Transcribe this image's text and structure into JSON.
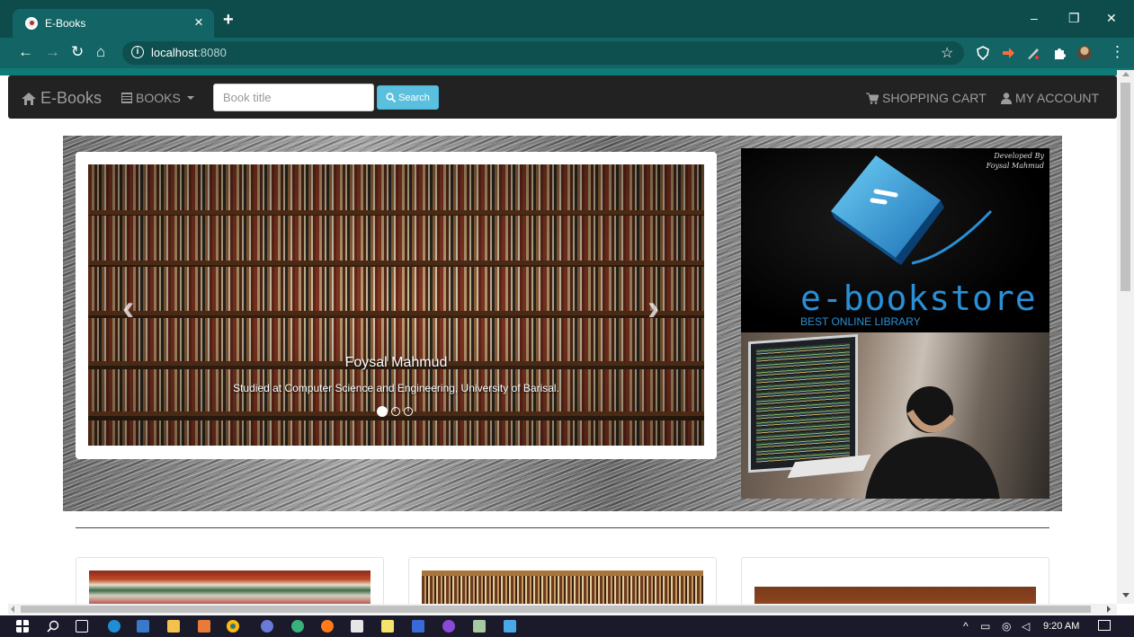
{
  "browser": {
    "tab_title": "E-Books",
    "tab_close": "×",
    "new_tab": "+",
    "url_host": "localhost",
    "url_port": ":8080",
    "minimize": "–",
    "restore": "❐",
    "close": "✕"
  },
  "navbar": {
    "brand": "E-Books",
    "books_menu": "BOOKS",
    "search_placeholder": "Book title",
    "search_button": "Search",
    "cart": "SHOPPING CART",
    "account": "MY ACCOUNT"
  },
  "carousel": {
    "caption_title": "Foysal Mahmud",
    "caption_text": "Studied at Computer Science and Engineering, University of Barisal.",
    "slides": 3,
    "active_slide": 1
  },
  "logo_panel": {
    "developed_line1": "Developed By",
    "developed_line2": "Foysal Mahmud",
    "title": "e-bookstore",
    "subtitle": "BEST ONLINE LIBRARY"
  },
  "taskbar": {
    "time": "9:20 AM"
  },
  "colors": {
    "tabbar": "#0e4c4c",
    "toolbar": "#136464",
    "navbar": "#222222",
    "search_button": "#5bc0de",
    "logo_blue": "#2a8fd6"
  }
}
